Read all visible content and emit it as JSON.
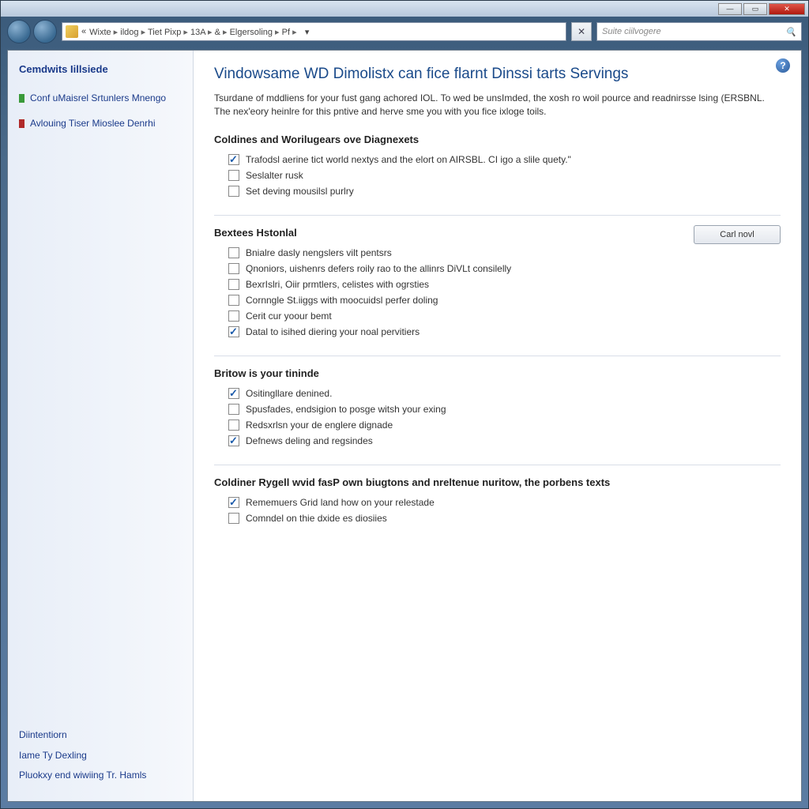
{
  "titlebar": {
    "minimize": "—",
    "maximize": "▭",
    "close": "✕"
  },
  "address": {
    "crumbs": [
      "Wixte",
      "ildog",
      "Tiet Pixp",
      "13A",
      "&",
      "Elgersoling",
      "Pf"
    ],
    "dropdown": "▾",
    "refresh": "✕"
  },
  "search": {
    "placeholder": "Suite ciilvogere",
    "icon": "🔍"
  },
  "sidebar": {
    "title": "Cemdwits Iillsiede",
    "links": [
      {
        "label": "Conf uMaisrel Srtunlers Mnengo"
      },
      {
        "label": "Avlouing Tiser Mioslee Denrhi"
      }
    ],
    "bottom": [
      "Diintentiorn",
      "Iame Ty Dexling",
      "Pluokxy end wiwiing Tr. Hamls"
    ]
  },
  "main": {
    "help": "?",
    "title": "Vindowsame WD Dimolistx can fice flarnt Dinssi tarts Servings",
    "desc": "Tsurdane of mddliens for your fust gang achored IOL. To wed be unsImded, the xosh ro woil pource and readnirsse lsing (ERSBNL. The nex'eory heinlre for this pntive and herve sme you with you fice ixloge toils.",
    "sections": [
      {
        "title": "Coldines and Worilugears ove Diagnexets",
        "button": null,
        "items": [
          {
            "checked": true,
            "label": "Trafodsl aerine tict world nextys and the elort on AIRSBL. CI igo a slile quety.\""
          },
          {
            "checked": false,
            "label": "Seslalter rusk"
          },
          {
            "checked": false,
            "label": "Set deving mousilsl purlry"
          }
        ]
      },
      {
        "title": "Bextees Hstonlal",
        "button": "Carl novl",
        "items": [
          {
            "checked": false,
            "label": "Bnialre dasly nengslers vilt pentsrs"
          },
          {
            "checked": false,
            "label": "Qnoniors, uishenrs defers roily rao to the allinrs DiVLt consilelly"
          },
          {
            "checked": false,
            "label": "BexrIslri, Oiir prmtlers, celistes with ogrsties"
          },
          {
            "checked": false,
            "label": "Cornngle St.iiggs with moocuidsl perfer doling"
          },
          {
            "checked": false,
            "label": "Cerit cur yoour bemt"
          },
          {
            "checked": true,
            "label": "Datal to isihed diering your noal pervitiers"
          }
        ]
      },
      {
        "title": "Britow is your tininde",
        "button": null,
        "items": [
          {
            "checked": true,
            "label": "Ositingllare denined."
          },
          {
            "checked": false,
            "label": "Spusfades, endsigion to posge witsh your exing"
          },
          {
            "checked": false,
            "label": "Redsxrlsn your de englere dignade"
          },
          {
            "checked": true,
            "label": "Defnews deling and regsindes"
          }
        ]
      },
      {
        "title": "Coldiner Rygell wvid fasP own biugtons and nreltenue nuritow, the porbens texts",
        "button": null,
        "items": [
          {
            "checked": true,
            "label": "Rememuers Grid land how on your relestade"
          },
          {
            "checked": false,
            "label": "Comndel on thie dxide es diosiies"
          }
        ]
      }
    ]
  }
}
